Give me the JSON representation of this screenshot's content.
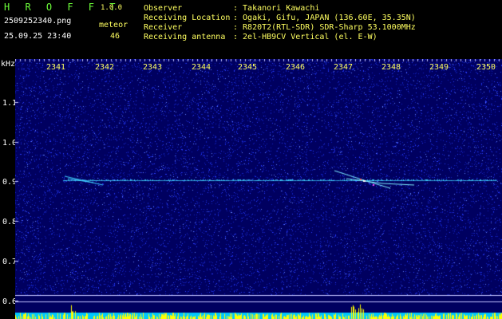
{
  "app": {
    "name": "H R O F F T",
    "version": "1.0.0"
  },
  "file": {
    "name": "2509252340.png",
    "datetime": "25.09.25 23:40"
  },
  "meteor": {
    "label": "meteor",
    "count": "46"
  },
  "info": {
    "observer_label": "Observer",
    "observer_value": ": Takanori Kawachi",
    "location_label": "Receiving Location",
    "location_value": ": Ogaki, Gifu, JAPAN (136.60E, 35.35N)",
    "receiver_label": "Receiver",
    "receiver_value": ": R820T2(RTL-SDR) SDR-Sharp 53.1000MHz",
    "antenna_label": "Receiving antenna",
    "antenna_value": ": 2el-HB9CV Vertical (el. E-W)"
  },
  "axis": {
    "y_unit": "kHz",
    "y_ticks": [
      "1.1",
      "1.0",
      "0.9",
      "0.8",
      "0.7",
      "0.6"
    ],
    "x_ticks": [
      "2341",
      "2342",
      "2343",
      "2344",
      "2345",
      "2346",
      "2347",
      "2348",
      "2349",
      "2350"
    ]
  },
  "colors": {
    "background": "#000060",
    "noise": "#2a3cff",
    "signal": "#40d0ff",
    "level_bar": "#ffff00",
    "level_base": "#00c8ff"
  }
}
